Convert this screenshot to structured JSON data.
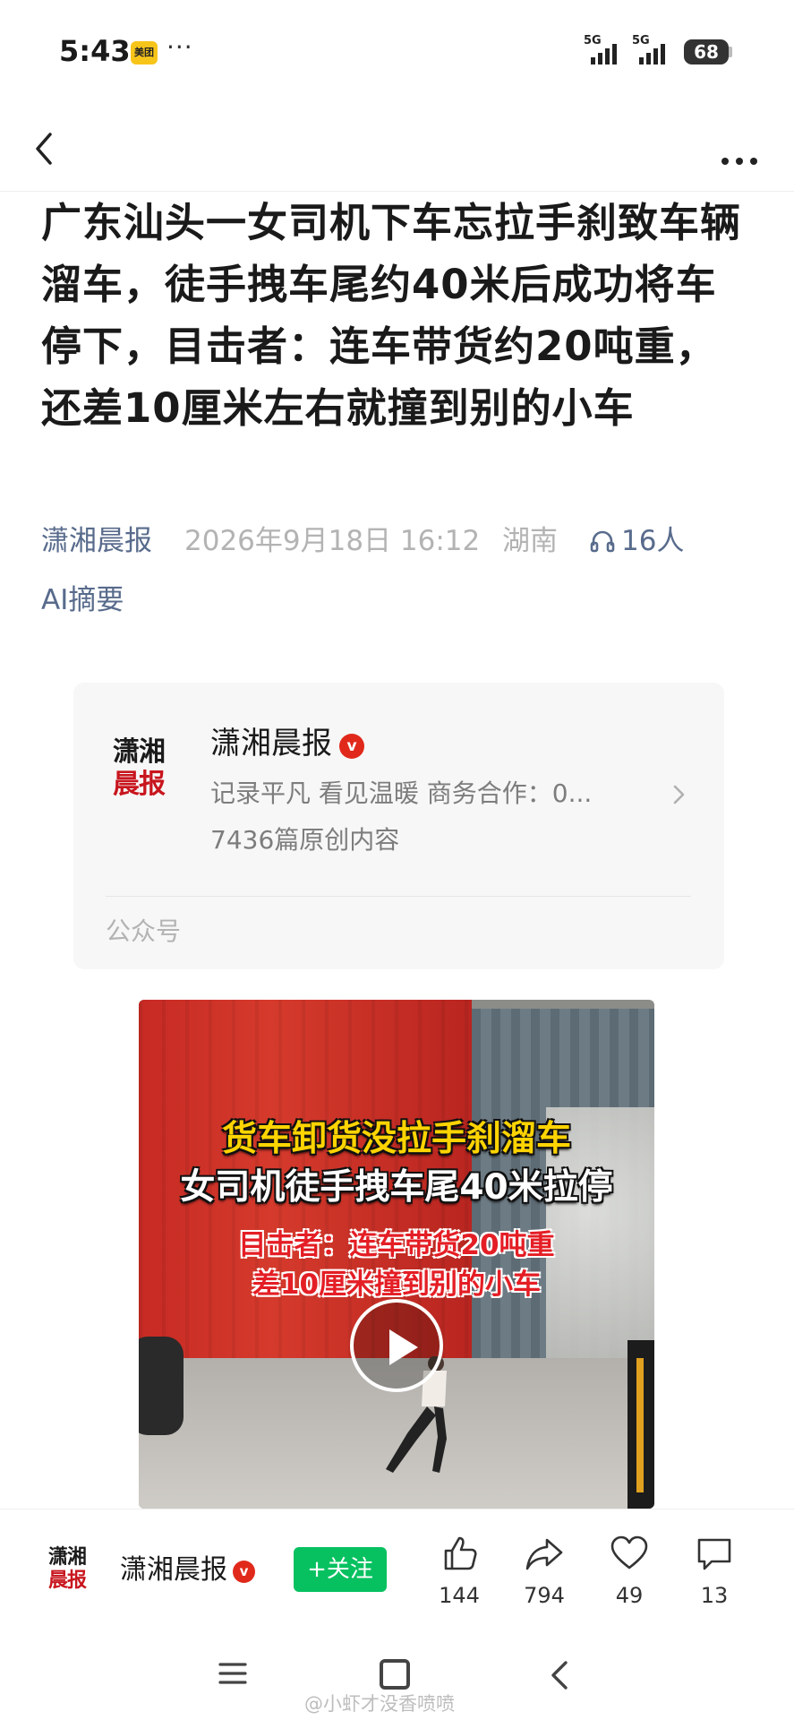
{
  "status_bar": {
    "time": "5:43",
    "app_badge": "美团",
    "more_dots": "···",
    "network1": "5G",
    "network2": "5G",
    "battery": "68"
  },
  "nav": {
    "back_icon": "chevron-left-icon",
    "more_icon": "more-horizontal-icon"
  },
  "article": {
    "title": "广东汕头一女司机下车忘拉手刹致车辆溜车，徒手拽车尾约40米后成功将车停下，目击者：连车带货约20吨重，还差10厘米左右就撞到别的小车",
    "source": "潇湘晨报",
    "date": "2026年9月18日 16:12",
    "region": "湖南",
    "listeners": "16人",
    "ai_summary": "AI摘要"
  },
  "account_card": {
    "logo_line1": "潇湘",
    "logo_line2": "晨报",
    "name": "潇湘晨报",
    "verified_badge": "v",
    "description": "记录平凡 看见温暖 商务合作：0...",
    "original_count": "7436篇原创内容",
    "type_label": "公众号"
  },
  "video": {
    "caption_line1": "货车卸货没拉手刹溜车",
    "caption_line2": "女司机徒手拽车尾40米拉停",
    "caption_line3": "目击者：连车带货20吨重",
    "caption_line4": "差10厘米撞到别的小车",
    "play_icon": "play-icon"
  },
  "action_bar": {
    "logo_line1": "潇湘",
    "logo_line2": "晨报",
    "name": "潇湘晨报",
    "follow_label": "+关注",
    "likes": "144",
    "shares": "794",
    "favorites": "49",
    "comments": "13"
  },
  "system_nav": {
    "watermark": "@小虾才没香喷喷"
  },
  "colors": {
    "follow_green": "#07c160",
    "link_blue_gray": "#586b8c",
    "verified_red": "#e0291b",
    "brand_red": "#c8161e"
  }
}
